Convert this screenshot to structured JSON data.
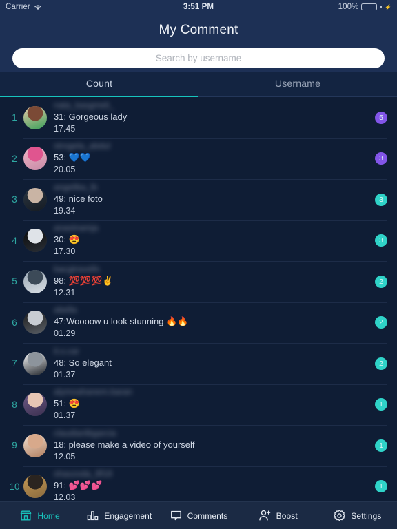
{
  "status_bar": {
    "carrier": "Carrier",
    "wifi_icon": "wifi-icon",
    "time": "3:51 PM",
    "battery_percent": "100%",
    "battery_icon": "battery-full-charging-icon"
  },
  "header": {
    "title": "My Comment"
  },
  "search": {
    "placeholder": "Search by username",
    "value": ""
  },
  "tabs": {
    "items": [
      {
        "label": "Count",
        "active": true
      },
      {
        "label": "Username",
        "active": false
      }
    ],
    "active_color": "#17c4bd"
  },
  "colors": {
    "header_bg": "#1d3055",
    "list_bg": "#0f1d35",
    "accent_teal": "#19c2bb",
    "badge_purple": "#8255e8",
    "badge_teal": "#2fd3c8",
    "rank_teal": "#2fa8a3",
    "tabbar_bg": "#1b2a44"
  },
  "list": {
    "rows": [
      {
        "rank": "1",
        "username": "nata_kasgmeli_",
        "comment": "31: Gorgeous lady",
        "time": "17.45",
        "badge": "5",
        "badge_color": "#8255e8",
        "avatar_colors": [
          "#e8c9a8",
          "#7b4a36",
          "#3aa05a"
        ]
      },
      {
        "rank": "2",
        "username": "strogela_abdul",
        "comment": "53: 💙💙",
        "time": "20.05",
        "badge": "3",
        "badge_color": "#8255e8",
        "avatar_colors": [
          "#f0b7c8",
          "#e0558f",
          "#c78aa6"
        ]
      },
      {
        "rank": "3",
        "username": "angelika_lb",
        "comment": "49: nice foto",
        "time": "19.34",
        "badge": "3",
        "badge_color": "#2fd3c8",
        "avatar_colors": [
          "#2b3642",
          "#c9b4a4",
          "#151b22"
        ]
      },
      {
        "rank": "4",
        "username": "anastnamja",
        "comment": "30: 😍",
        "time": "17.30",
        "badge": "3",
        "badge_color": "#2fd3c8",
        "avatar_colors": [
          "#0a0a0a",
          "#dfe3e8",
          "#2a2f36"
        ]
      },
      {
        "rank": "5",
        "username": "bacgtravells",
        "comment": "98: 💯💯💯✌️",
        "time": "12.31",
        "badge": "2",
        "badge_color": "#2fd3c8",
        "avatar_colors": [
          "#9aa7b4",
          "#3c4a58",
          "#d8dee4"
        ]
      },
      {
        "rank": "6",
        "username": "abella",
        "comment": "47:Woooow u look stunning 🔥🔥",
        "time": "01.29",
        "badge": "2",
        "badge_color": "#2fd3c8",
        "avatar_colors": [
          "#1a1a1a",
          "#c8ccd2",
          "#5a5f66"
        ]
      },
      {
        "rank": "7",
        "username": "it.s.car",
        "comment": "48: So elegant",
        "time": "01.37",
        "badge": "2",
        "badge_color": "#2fd3c8",
        "avatar_colors": [
          "#ffffff",
          "#8d949c",
          "#20242a"
        ]
      },
      {
        "rank": "8",
        "username": "alymoahanem.baran",
        "comment": "51: 😍",
        "time": "01.37",
        "badge": "1",
        "badge_color": "#2fd3c8",
        "avatar_colors": [
          "#6e5a86",
          "#e7c6b4",
          "#3b3050"
        ]
      },
      {
        "rank": "9",
        "username": "claudianlbgarcia",
        "comment": "18: please make a video of yourself",
        "time": "12.05",
        "badge": "1",
        "badge_color": "#2fd3c8",
        "avatar_colors": [
          "#f2e3d5",
          "#d8a98b",
          "#b07d5e"
        ]
      },
      {
        "rank": "10",
        "username": "shaxzoda_8f18",
        "comment": "91: 💕💕💕",
        "time": "12.03",
        "badge": "1",
        "badge_color": "#2fd3c8",
        "avatar_colors": [
          "#c79a54",
          "#2a2420",
          "#8a6b3f"
        ]
      }
    ]
  },
  "tabbar": {
    "items": [
      {
        "label": "Home",
        "icon": "store-icon",
        "active": true
      },
      {
        "label": "Engagement",
        "icon": "bar-chart-icon",
        "active": false
      },
      {
        "label": "Comments",
        "icon": "speech-bubble-icon",
        "active": false
      },
      {
        "label": "Boost",
        "icon": "person-plus-icon",
        "active": false
      },
      {
        "label": "Settings",
        "icon": "gear-icon",
        "active": false
      }
    ]
  }
}
